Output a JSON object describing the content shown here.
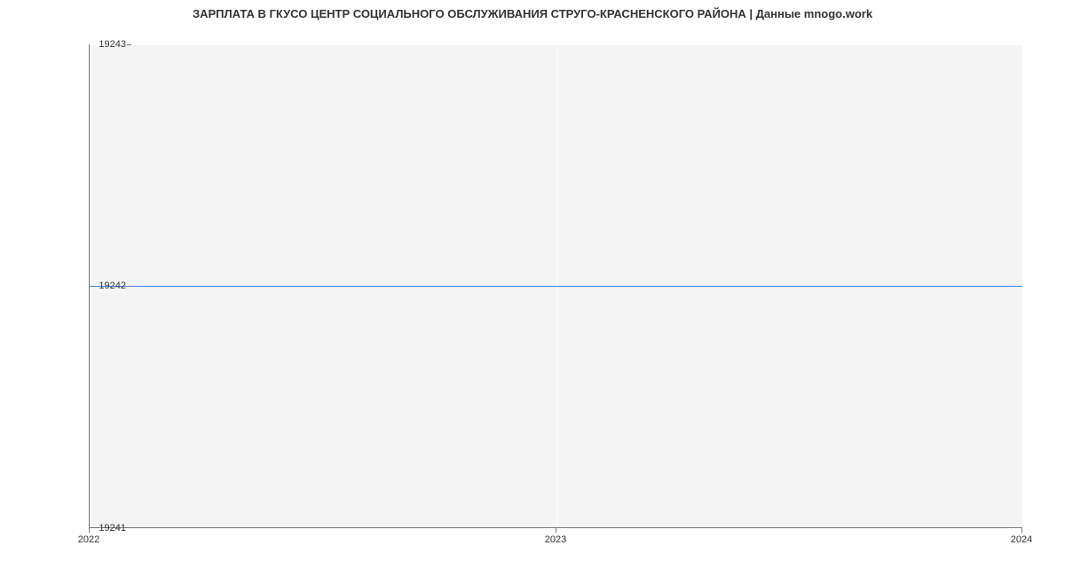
{
  "chart_data": {
    "type": "line",
    "title": "ЗАРПЛАТА В ГКУСО ЦЕНТР СОЦИАЛЬНОГО ОБСЛУЖИВАНИЯ СТРУГО-КРАСНЕНСКОГО РАЙОНА | Данные mnogo.work",
    "x": [
      2022,
      2023,
      2024
    ],
    "values": [
      19242,
      19242,
      19242
    ],
    "xlabel": "",
    "ylabel": "",
    "x_ticks": [
      "2022",
      "2023",
      "2024"
    ],
    "y_ticks": [
      "19241",
      "19242",
      "19243"
    ],
    "xlim": [
      2022,
      2024
    ],
    "ylim": [
      19241,
      19243
    ]
  }
}
